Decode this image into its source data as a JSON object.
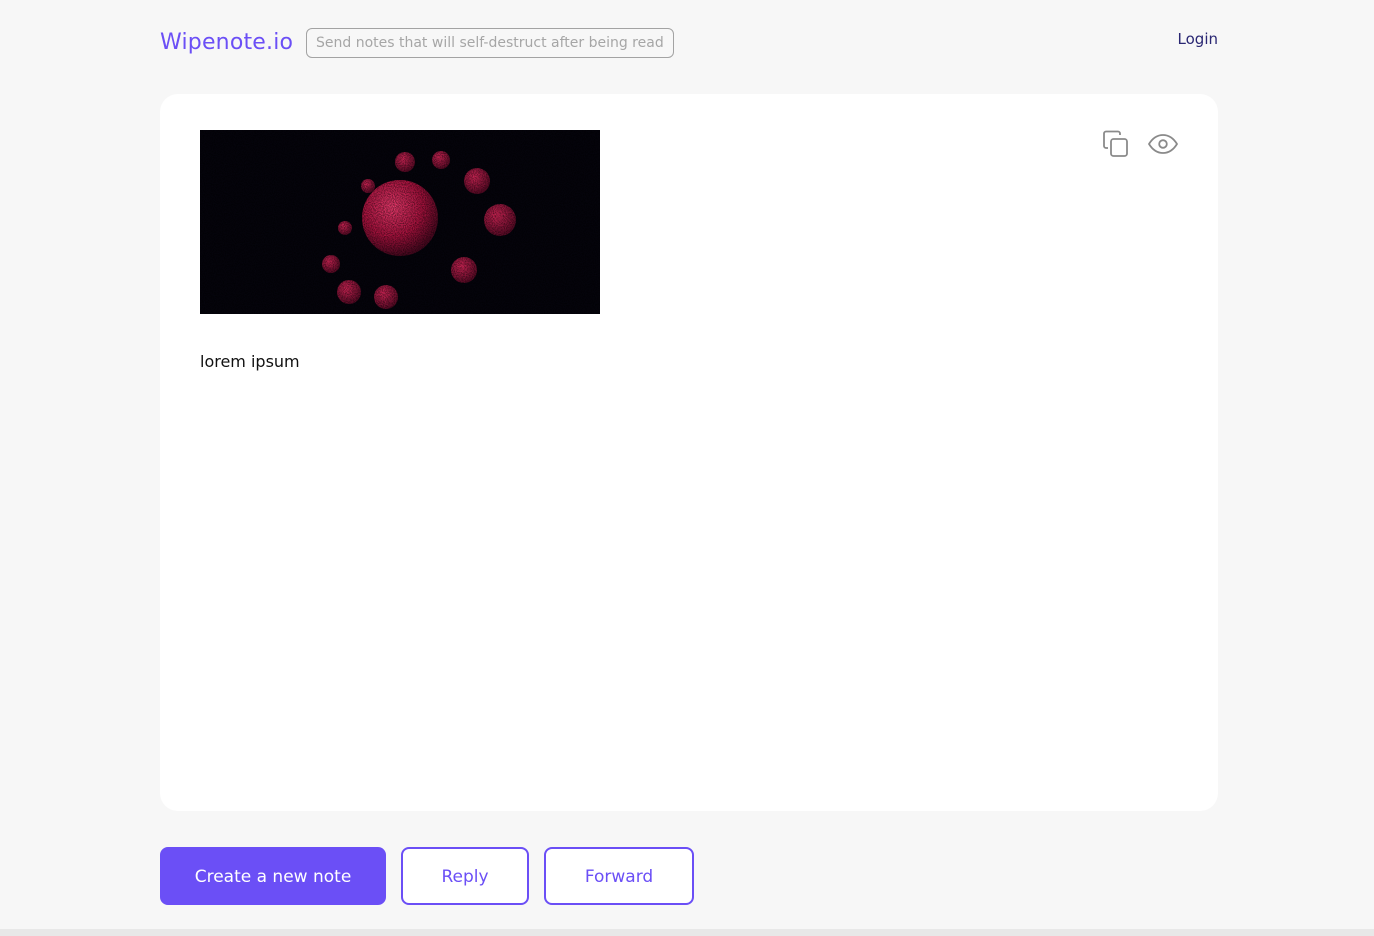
{
  "header": {
    "logo": "Wipenote.io",
    "tagline": "Send notes that will self-destruct after being read",
    "login_label": "Login"
  },
  "note": {
    "text": "lorem ipsum",
    "icons": {
      "copy": "copy-icon",
      "view": "eye-icon"
    }
  },
  "actions": {
    "create_label": "Create a new note",
    "reply_label": "Reply",
    "forward_label": "Forward"
  },
  "colors": {
    "accent": "#6b4ff6",
    "background": "#f7f7f7",
    "card": "#ffffff",
    "login_text": "#2a2773",
    "image_bg": "#05040c",
    "image_particles": "#c2184a"
  }
}
